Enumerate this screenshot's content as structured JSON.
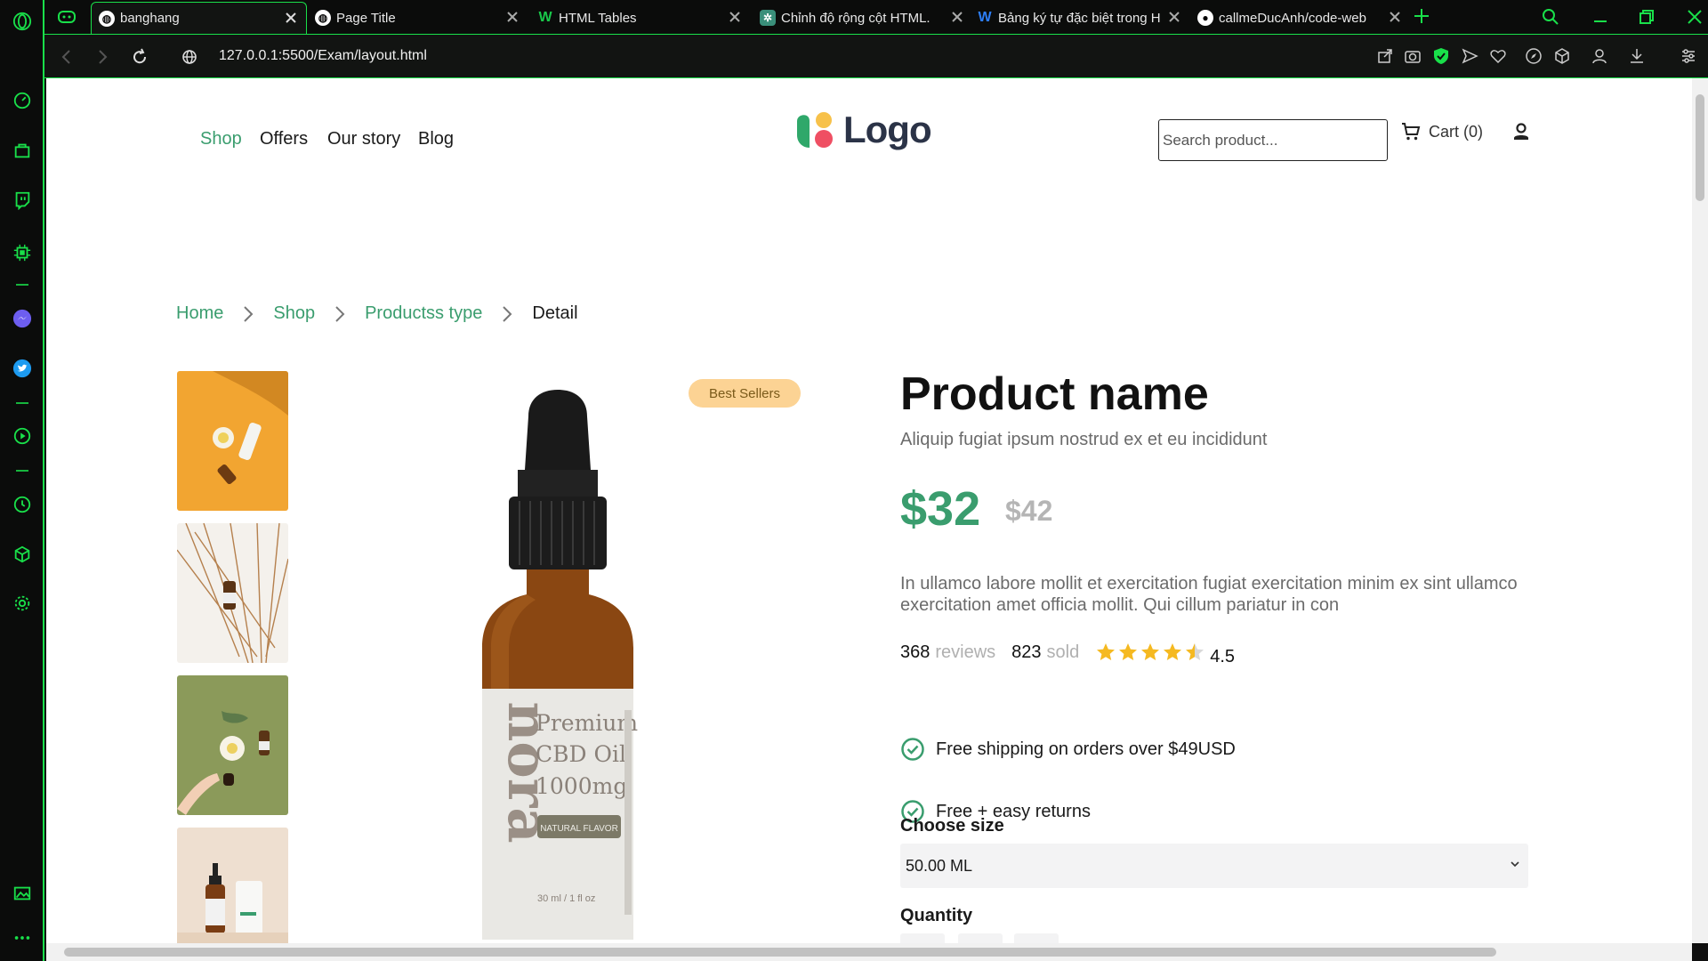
{
  "browser": {
    "tabs": [
      {
        "title": "banghang",
        "active": true
      },
      {
        "title": "Page Title",
        "active": false
      },
      {
        "title": "HTML Tables",
        "active": false
      },
      {
        "title": "Chỉnh độ rộng cột HTML.",
        "active": false
      },
      {
        "title": "Bảng ký tự đặc biệt trong H",
        "active": false
      },
      {
        "title": "callmeDucAnh/code-web",
        "active": false
      }
    ],
    "url": "127.0.0.1:5500/Exam/layout.html",
    "accent": "#19e04a"
  },
  "site": {
    "nav": [
      {
        "label": "Shop",
        "active": true
      },
      {
        "label": "Offers",
        "active": false
      },
      {
        "label": "Our story",
        "active": false
      },
      {
        "label": "Blog",
        "active": false
      }
    ],
    "logo_text": "Logo",
    "search_placeholder": "Search product...",
    "cart_label": "Cart (0)",
    "accent": "#3a9d6e"
  },
  "breadcrumb": [
    "Home",
    "Shop",
    "Productss type",
    "Detail"
  ],
  "product": {
    "badge": "Best Sellers",
    "name": "Product name",
    "subtitle": "Aliquip fugiat ipsum nostrud ex et eu incididunt",
    "price": "$32",
    "old_price": "$42",
    "description": "In ullamco labore mollit et exercitation fugiat exercitation minim ex sint ullamco exercitation amet officia mollit. Qui cillum pariatur in con",
    "reviews_count": "368",
    "reviews_label": "reviews",
    "sold_count": "823",
    "sold_label": "sold",
    "rating": "4.5",
    "rating_value": 4.5,
    "features": [
      "Free shipping on orders over $49USD",
      "Free + easy returns"
    ],
    "size_label": "Choose size",
    "size_selected": "50.00 ML",
    "quantity_label": "Quantity",
    "bottle_label": {
      "brand": "nora",
      "line1": "Premium",
      "line2": "CBD Oil",
      "line3": "1000mg",
      "flavor": "NATURAL FLAVOR",
      "volume": "30 ml / 1 fl oz"
    }
  }
}
